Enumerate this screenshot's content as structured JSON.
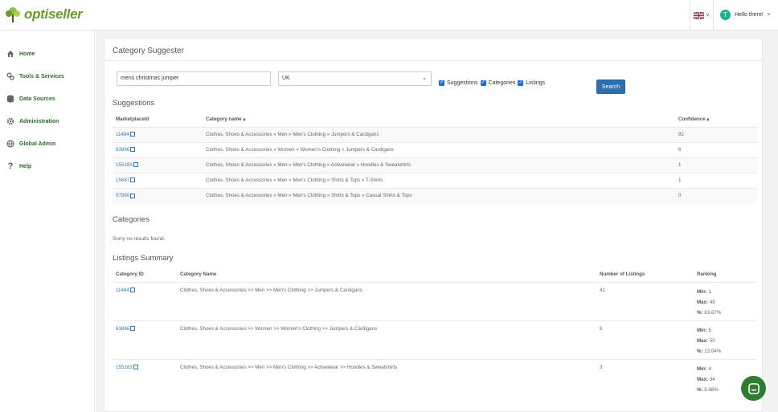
{
  "app": {
    "logo_text": "optiseller"
  },
  "topbar": {
    "lang_caret": "˅",
    "avatar_letter": "T",
    "greeting": "Hello there!",
    "greeting_caret": "˅"
  },
  "sidebar": {
    "items": [
      {
        "label": "Home",
        "icon": "home-icon"
      },
      {
        "label": "Tools & Services",
        "icon": "tools-icon"
      },
      {
        "label": "Data Sources",
        "icon": "database-icon"
      },
      {
        "label": "Administration",
        "icon": "gear-icon"
      },
      {
        "label": "Global Admin",
        "icon": "globe-icon"
      },
      {
        "label": "Help",
        "icon": "help-icon"
      }
    ]
  },
  "panel": {
    "title": "Category Suggester"
  },
  "search": {
    "query": "mens christmas jumper",
    "marketplace": "UK",
    "checkboxes": [
      "Suggestions",
      "Categories",
      "Listings"
    ],
    "button": "Search"
  },
  "suggestions": {
    "title": "Suggestions",
    "headers": [
      "MarketplaceId",
      "Category name ▴",
      "Confidence ▴"
    ],
    "rows": [
      {
        "id": "11484",
        "name": "Clothes, Shoes & Accessories » Men » Men's Clothing » Jumpers & Cardigans",
        "confidence": "92"
      },
      {
        "id": "63866",
        "name": "Clothes, Shoes & Accessories » Women » Women's Clothing » Jumpers & Cardigans",
        "confidence": "6"
      },
      {
        "id": "155183",
        "name": "Clothes, Shoes & Accessories » Men » Men's Clothing » Activewear » Hoodies & Sweatshirts",
        "confidence": "1"
      },
      {
        "id": "15687",
        "name": "Clothes, Shoes & Accessories » Men » Men's Clothing » Shirts & Tops » T-Shirts",
        "confidence": "1"
      },
      {
        "id": "57990",
        "name": "Clothes, Shoes & Accessories » Men » Men's Clothing » Shirts & Tops » Casual Shirts & Tops",
        "confidence": "0"
      }
    ]
  },
  "categories": {
    "title": "Categories",
    "empty": "Sorry no results found."
  },
  "listings": {
    "title": "Listings Summary",
    "headers": [
      "Category ID",
      "Category Name",
      "Number of Listings",
      "Ranking"
    ],
    "rows": [
      {
        "id": "11484",
        "name": "Clothes, Shoes & Accessories >> Men >> Men's Clothing >> Jumpers & Cardigans",
        "count": "41",
        "min": "1",
        "max": "49",
        "pct": "83.67%"
      },
      {
        "id": "63866",
        "name": "Clothes, Shoes & Accessories >> Women >> Women's Clothing >> Jumpers & Cardigans",
        "count": "6",
        "min": "5",
        "max": "50",
        "pct": "13.04%"
      },
      {
        "id": "155183",
        "name": "Clothes, Shoes & Accessories >> Men >> Men's Clothing >> Activewear >> Hoodies & Sweatshirts",
        "count": "3",
        "min": "4",
        "max": "34",
        "pct": "9.68%"
      }
    ],
    "labels": {
      "min": "Min:",
      "max": "Max:",
      "pct": "%:"
    }
  },
  "colors": {
    "accent": "#2f6fad",
    "brand": "#6a9a2e",
    "link": "#337ab7",
    "chat": "#2e7d32"
  }
}
